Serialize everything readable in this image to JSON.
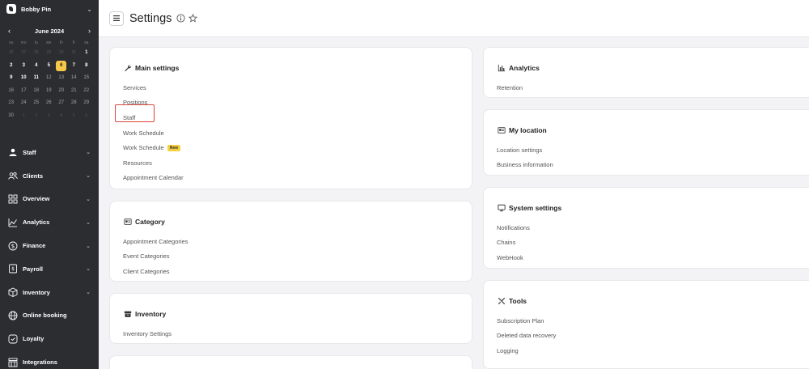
{
  "account": {
    "name": "Bobby Pin"
  },
  "calendar": {
    "title": "June 2024",
    "prev": "‹",
    "next": "›",
    "weekdays": [
      "su",
      "mo",
      "tu",
      "we",
      "th",
      "fr",
      "sa"
    ],
    "rows": [
      [
        {
          "d": "26",
          "t": "other"
        },
        {
          "d": "27",
          "t": "other"
        },
        {
          "d": "28",
          "t": "other"
        },
        {
          "d": "29",
          "t": "other"
        },
        {
          "d": "30",
          "t": "other"
        },
        {
          "d": "31",
          "t": "other"
        },
        {
          "d": "1",
          "t": "cur"
        }
      ],
      [
        {
          "d": "2",
          "t": "cur"
        },
        {
          "d": "3",
          "t": "cur"
        },
        {
          "d": "4",
          "t": "cur"
        },
        {
          "d": "5",
          "t": "cur"
        },
        {
          "d": "6",
          "t": "today"
        },
        {
          "d": "7",
          "t": "cur"
        },
        {
          "d": "8",
          "t": "cur"
        }
      ],
      [
        {
          "d": "9",
          "t": "cur"
        },
        {
          "d": "10",
          "t": "cur"
        },
        {
          "d": "11",
          "t": "cur"
        },
        {
          "d": "12",
          "t": "muted"
        },
        {
          "d": "13",
          "t": "muted"
        },
        {
          "d": "14",
          "t": "muted"
        },
        {
          "d": "15",
          "t": "muted"
        }
      ],
      [
        {
          "d": "16",
          "t": "muted"
        },
        {
          "d": "17",
          "t": "muted"
        },
        {
          "d": "18",
          "t": "muted"
        },
        {
          "d": "19",
          "t": "muted"
        },
        {
          "d": "20",
          "t": "muted"
        },
        {
          "d": "21",
          "t": "muted"
        },
        {
          "d": "22",
          "t": "muted"
        }
      ],
      [
        {
          "d": "23",
          "t": "muted"
        },
        {
          "d": "24",
          "t": "muted"
        },
        {
          "d": "25",
          "t": "muted"
        },
        {
          "d": "26",
          "t": "muted"
        },
        {
          "d": "27",
          "t": "muted"
        },
        {
          "d": "28",
          "t": "muted"
        },
        {
          "d": "29",
          "t": "muted"
        }
      ],
      [
        {
          "d": "30",
          "t": "muted"
        },
        {
          "d": "1",
          "t": "other"
        },
        {
          "d": "2",
          "t": "other"
        },
        {
          "d": "3",
          "t": "other"
        },
        {
          "d": "4",
          "t": "other"
        },
        {
          "d": "5",
          "t": "other"
        },
        {
          "d": "6",
          "t": "other"
        }
      ]
    ]
  },
  "nav": {
    "items": [
      {
        "label": "Staff",
        "icon": "person-icon",
        "has_chevron": true
      },
      {
        "label": "Clients",
        "icon": "people-icon",
        "has_chevron": true
      },
      {
        "label": "Overview",
        "icon": "grid-icon",
        "has_chevron": true
      },
      {
        "label": "Analytics",
        "icon": "chart-icon",
        "has_chevron": true
      },
      {
        "label": "Finance",
        "icon": "dollar-icon",
        "has_chevron": true
      },
      {
        "label": "Payroll",
        "icon": "payroll-icon",
        "has_chevron": true
      },
      {
        "label": "Inventory",
        "icon": "box-icon",
        "has_chevron": true
      },
      {
        "label": "Online booking",
        "icon": "globe-icon",
        "has_chevron": false
      },
      {
        "label": "Loyalty",
        "icon": "loyalty-icon",
        "has_chevron": false
      },
      {
        "label": "Integrations",
        "icon": "integrations-icon",
        "has_chevron": false
      }
    ]
  },
  "header": {
    "title": "Settings"
  },
  "cards": {
    "main_settings": {
      "title": "Main settings",
      "links": [
        "Services",
        "Positions",
        "Staff",
        "Work Schedule",
        "Work Schedule",
        "Resources",
        "Appointment Calendar"
      ],
      "badge": "New"
    },
    "category": {
      "title": "Category",
      "links": [
        "Appointment Categories",
        "Event Categories",
        "Client Categories"
      ]
    },
    "inventory": {
      "title": "Inventory",
      "links": [
        "Inventory Settings"
      ]
    },
    "analytics": {
      "title": "Analytics",
      "links": [
        "Retention"
      ]
    },
    "my_location": {
      "title": "My location",
      "links": [
        "Location settings",
        "Business information"
      ]
    },
    "system_settings": {
      "title": "System settings",
      "links": [
        "Notifications",
        "Chains",
        "WebHook"
      ]
    },
    "tools": {
      "title": "Tools",
      "links": [
        "Subscription Plan",
        "Deleted data recovery",
        "Logging"
      ]
    }
  },
  "colors": {
    "sidebar": "#2b2d31",
    "today": "#f5c84a",
    "highlight": "#d9453c",
    "badge": "#f5d03e"
  }
}
